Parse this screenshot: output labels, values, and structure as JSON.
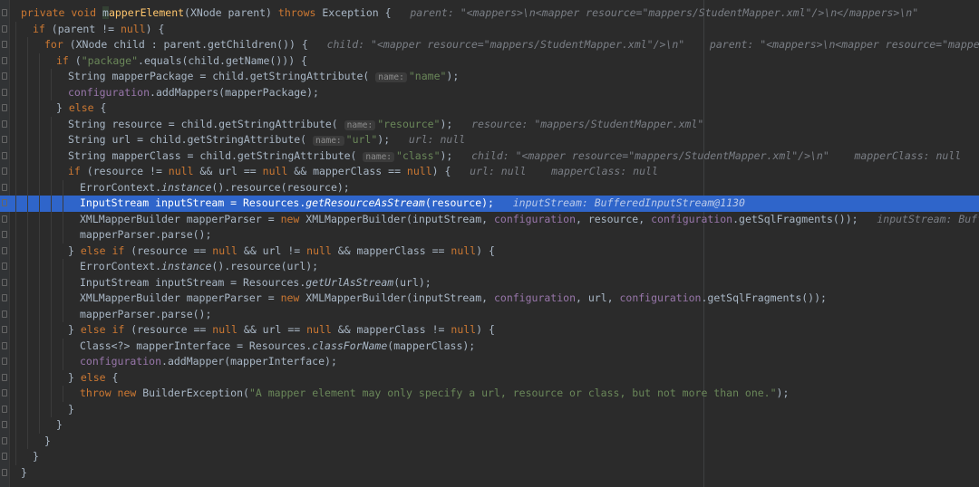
{
  "editor": {
    "language": "java",
    "highlighted_line": 13,
    "colors": {
      "background": "#2b2b2b",
      "keyword": "#cc7832",
      "string": "#6a8759",
      "field": "#9876aa",
      "method_decl": "#ffc66d",
      "inline_hint": "#7a7e85",
      "selection": "#2f65ca"
    },
    "lines": [
      {
        "indent": 1,
        "tokens": [
          [
            "kw",
            "private void "
          ],
          [
            "cursor",
            "m"
          ],
          [
            "fn",
            "apperElement"
          ],
          [
            "plain",
            "(XNode parent) "
          ],
          [
            "kw",
            "throws "
          ],
          [
            "plain",
            "Exception {   "
          ],
          [
            "hint",
            "parent: \"<mappers>\\n<mapper resource=\"mappers/StudentMapper.xml\"/>\\n</mappers>\\n\""
          ]
        ]
      },
      {
        "indent": 2,
        "tokens": [
          [
            "kw",
            "if "
          ],
          [
            "plain",
            "(parent != "
          ],
          [
            "kw",
            "null"
          ],
          [
            "plain",
            ") {"
          ]
        ]
      },
      {
        "indent": 3,
        "tokens": [
          [
            "kw",
            "for "
          ],
          [
            "plain",
            "(XNode child : parent.getChildren()) {   "
          ],
          [
            "hint",
            "child: \"<mapper resource=\"mappers/StudentMapper.xml\"/>\\n\"    parent: \"<mappers>\\n<mapper resource=\"mappers/StudentMapper.xml\"/>"
          ]
        ]
      },
      {
        "indent": 4,
        "tokens": [
          [
            "kw",
            "if "
          ],
          [
            "plain",
            "("
          ],
          [
            "str",
            "\"package\""
          ],
          [
            "plain",
            ".equals(child.getName())) {"
          ]
        ]
      },
      {
        "indent": 5,
        "tokens": [
          [
            "plain",
            "String mapperPackage = child.getStringAttribute( "
          ],
          [
            "param",
            "name:"
          ],
          [
            "str",
            "\"name\""
          ],
          [
            "plain",
            ");"
          ]
        ]
      },
      {
        "indent": 5,
        "tokens": [
          [
            "field",
            "configuration"
          ],
          [
            "plain",
            ".addMappers(mapperPackage);"
          ]
        ]
      },
      {
        "indent": 4,
        "tokens": [
          [
            "plain",
            "} "
          ],
          [
            "kw",
            "else "
          ],
          [
            "plain",
            "{"
          ]
        ]
      },
      {
        "indent": 5,
        "tokens": [
          [
            "plain",
            "String resource = child.getStringAttribute( "
          ],
          [
            "param",
            "name:"
          ],
          [
            "str",
            "\"resource\""
          ],
          [
            "plain",
            ");   "
          ],
          [
            "hint",
            "resource: \"mappers/StudentMapper.xml\""
          ]
        ]
      },
      {
        "indent": 5,
        "tokens": [
          [
            "plain",
            "String url = child.getStringAttribute( "
          ],
          [
            "param",
            "name:"
          ],
          [
            "str",
            "\"url\""
          ],
          [
            "plain",
            ");   "
          ],
          [
            "hint",
            "url: null"
          ]
        ]
      },
      {
        "indent": 5,
        "tokens": [
          [
            "plain",
            "String mapperClass = child.getStringAttribute( "
          ],
          [
            "param",
            "name:"
          ],
          [
            "str",
            "\"class\""
          ],
          [
            "plain",
            ");   "
          ],
          [
            "hint",
            "child: \"<mapper resource=\"mappers/StudentMapper.xml\"/>\\n\"    mapperClass: null"
          ]
        ]
      },
      {
        "indent": 5,
        "tokens": [
          [
            "kw",
            "if "
          ],
          [
            "plain",
            "(resource != "
          ],
          [
            "kw",
            "null "
          ],
          [
            "plain",
            "&& url == "
          ],
          [
            "kw",
            "null "
          ],
          [
            "plain",
            "&& mapperClass == "
          ],
          [
            "kw",
            "null"
          ],
          [
            "plain",
            ") {   "
          ],
          [
            "hint",
            "url: null    mapperClass: null"
          ]
        ]
      },
      {
        "indent": 6,
        "tokens": [
          [
            "plain",
            "ErrorContext."
          ],
          [
            "static",
            "instance"
          ],
          [
            "plain",
            "().resource(resource);"
          ]
        ]
      },
      {
        "indent": 6,
        "tokens": [
          [
            "plain",
            "InputStream inputStream = Resources."
          ],
          [
            "static",
            "getResourceAsStream"
          ],
          [
            "plain",
            "(resource);   "
          ],
          [
            "hint",
            "inputStream: BufferedInputStream@1130"
          ]
        ]
      },
      {
        "indent": 6,
        "tokens": [
          [
            "plain",
            "XMLMapperBuilder mapperParser = "
          ],
          [
            "kw",
            "new "
          ],
          [
            "plain",
            "XMLMapperBuilder(inputStream, "
          ],
          [
            "field",
            "configuration"
          ],
          [
            "plain",
            ", resource, "
          ],
          [
            "field",
            "configuration"
          ],
          [
            "plain",
            ".getSqlFragments());   "
          ],
          [
            "hint",
            "inputStream: BufferedInputStr"
          ]
        ]
      },
      {
        "indent": 6,
        "tokens": [
          [
            "plain",
            "mapperParser.parse();"
          ]
        ]
      },
      {
        "indent": 5,
        "tokens": [
          [
            "plain",
            "} "
          ],
          [
            "kw",
            "else if "
          ],
          [
            "plain",
            "(resource == "
          ],
          [
            "kw",
            "null "
          ],
          [
            "plain",
            "&& url != "
          ],
          [
            "kw",
            "null "
          ],
          [
            "plain",
            "&& mapperClass == "
          ],
          [
            "kw",
            "null"
          ],
          [
            "plain",
            ") {"
          ]
        ]
      },
      {
        "indent": 6,
        "tokens": [
          [
            "plain",
            "ErrorContext."
          ],
          [
            "static",
            "instance"
          ],
          [
            "plain",
            "().resource(url);"
          ]
        ]
      },
      {
        "indent": 6,
        "tokens": [
          [
            "plain",
            "InputStream inputStream = Resources."
          ],
          [
            "static",
            "getUrlAsStream"
          ],
          [
            "plain",
            "(url);"
          ]
        ]
      },
      {
        "indent": 6,
        "tokens": [
          [
            "plain",
            "XMLMapperBuilder mapperParser = "
          ],
          [
            "kw",
            "new "
          ],
          [
            "plain",
            "XMLMapperBuilder(inputStream, "
          ],
          [
            "field",
            "configuration"
          ],
          [
            "plain",
            ", url, "
          ],
          [
            "field",
            "configuration"
          ],
          [
            "plain",
            ".getSqlFragments());"
          ]
        ]
      },
      {
        "indent": 6,
        "tokens": [
          [
            "plain",
            "mapperParser.parse();"
          ]
        ]
      },
      {
        "indent": 5,
        "tokens": [
          [
            "plain",
            "} "
          ],
          [
            "kw",
            "else if "
          ],
          [
            "plain",
            "(resource == "
          ],
          [
            "kw",
            "null "
          ],
          [
            "plain",
            "&& url == "
          ],
          [
            "kw",
            "null "
          ],
          [
            "plain",
            "&& mapperClass != "
          ],
          [
            "kw",
            "null"
          ],
          [
            "plain",
            ") {"
          ]
        ]
      },
      {
        "indent": 6,
        "tokens": [
          [
            "plain",
            "Class<?> mapperInterface = Resources."
          ],
          [
            "static",
            "classForName"
          ],
          [
            "plain",
            "(mapperClass);"
          ]
        ]
      },
      {
        "indent": 6,
        "tokens": [
          [
            "field",
            "configuration"
          ],
          [
            "plain",
            ".addMapper(mapperInterface);"
          ]
        ]
      },
      {
        "indent": 5,
        "tokens": [
          [
            "plain",
            "} "
          ],
          [
            "kw",
            "else "
          ],
          [
            "plain",
            "{"
          ]
        ]
      },
      {
        "indent": 6,
        "tokens": [
          [
            "kw",
            "throw new "
          ],
          [
            "plain",
            "BuilderException("
          ],
          [
            "str",
            "\"A mapper element may only specify a url, resource or class, but not more than one.\""
          ],
          [
            "plain",
            ");"
          ]
        ]
      },
      {
        "indent": 5,
        "tokens": [
          [
            "plain",
            "}"
          ]
        ]
      },
      {
        "indent": 4,
        "tokens": [
          [
            "plain",
            "}"
          ]
        ]
      },
      {
        "indent": 3,
        "tokens": [
          [
            "plain",
            "}"
          ]
        ]
      },
      {
        "indent": 2,
        "tokens": [
          [
            "plain",
            "}"
          ]
        ]
      },
      {
        "indent": 1,
        "tokens": [
          [
            "plain",
            "}"
          ]
        ]
      }
    ]
  }
}
